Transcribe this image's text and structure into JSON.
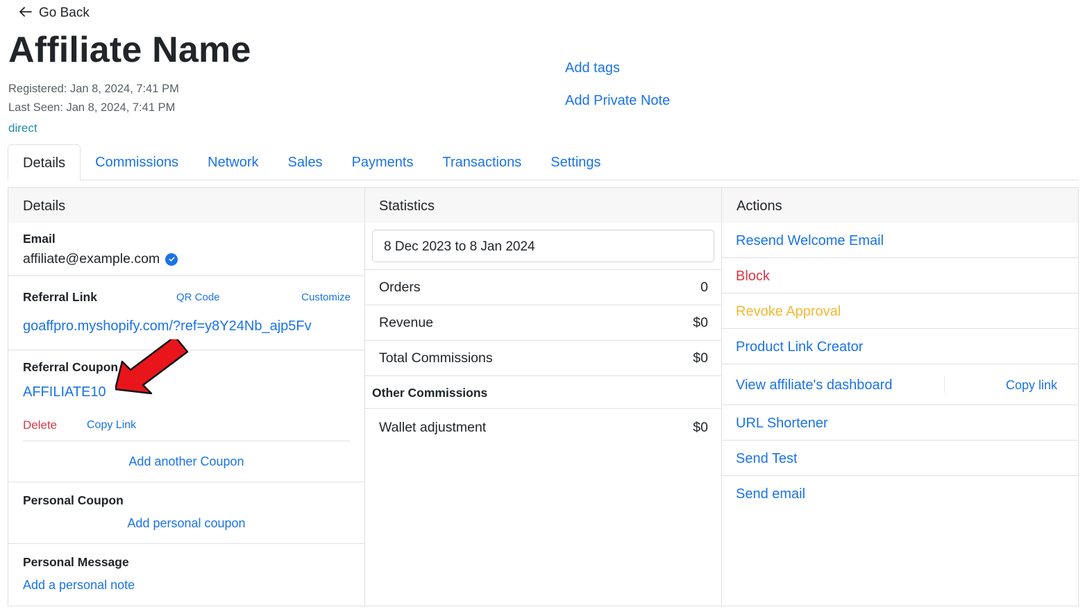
{
  "header": {
    "back_label": "Go Back",
    "title": "Affiliate Name",
    "registered": "Registered: Jan 8, 2024, 7:41 PM",
    "last_seen": "Last Seen: Jan 8, 2024, 7:41 PM",
    "source": "direct",
    "add_tags": "Add tags",
    "add_private_note": "Add Private Note"
  },
  "tabs": [
    {
      "label": "Details",
      "active": true
    },
    {
      "label": "Commissions"
    },
    {
      "label": "Network"
    },
    {
      "label": "Sales"
    },
    {
      "label": "Payments"
    },
    {
      "label": "Transactions"
    },
    {
      "label": "Settings"
    }
  ],
  "details": {
    "header": "Details",
    "email_label": "Email",
    "email_value": "affiliate@example.com",
    "referral_link_label": "Referral Link",
    "qr_code": "QR Code",
    "customize": "Customize",
    "referral_link": "goaffpro.myshopify.com/?ref=y8Y24Nb_ajp5Fv",
    "referral_coupon_label": "Referral Coupon",
    "coupon_code": "AFFILIATE10",
    "coupon_delete": "Delete",
    "coupon_copy_link": "Copy Link",
    "add_another_coupon": "Add another Coupon",
    "personal_coupon_label": "Personal Coupon",
    "add_personal_coupon": "Add personal coupon",
    "personal_message_label": "Personal Message",
    "add_personal_note": "Add a personal note"
  },
  "statistics": {
    "header": "Statistics",
    "date_range": "8 Dec 2023 to 8 Jan 2024",
    "rows": [
      {
        "label": "Orders",
        "value": "0"
      },
      {
        "label": "Revenue",
        "value": "$0"
      },
      {
        "label": "Total Commissions",
        "value": "$0"
      }
    ],
    "other_commissions_label": "Other Commissions",
    "wallet": {
      "label": "Wallet adjustment",
      "value": "$0"
    }
  },
  "actions": {
    "header": "Actions",
    "items": [
      {
        "label": "Resend Welcome Email"
      },
      {
        "label": "Block"
      },
      {
        "label": "Revoke Approval"
      },
      {
        "label": "Product Link Creator"
      },
      {
        "label": "View affiliate's dashboard",
        "secondary": "Copy link"
      },
      {
        "label": "URL Shortener"
      },
      {
        "label": "Send Test"
      },
      {
        "label": "Send email"
      }
    ]
  },
  "colors": {
    "link": "#1a73e8",
    "danger": "#dc3545",
    "warning": "#f5b731",
    "source": "#1f8fa5",
    "annotation_arrow": "#e8161b"
  }
}
